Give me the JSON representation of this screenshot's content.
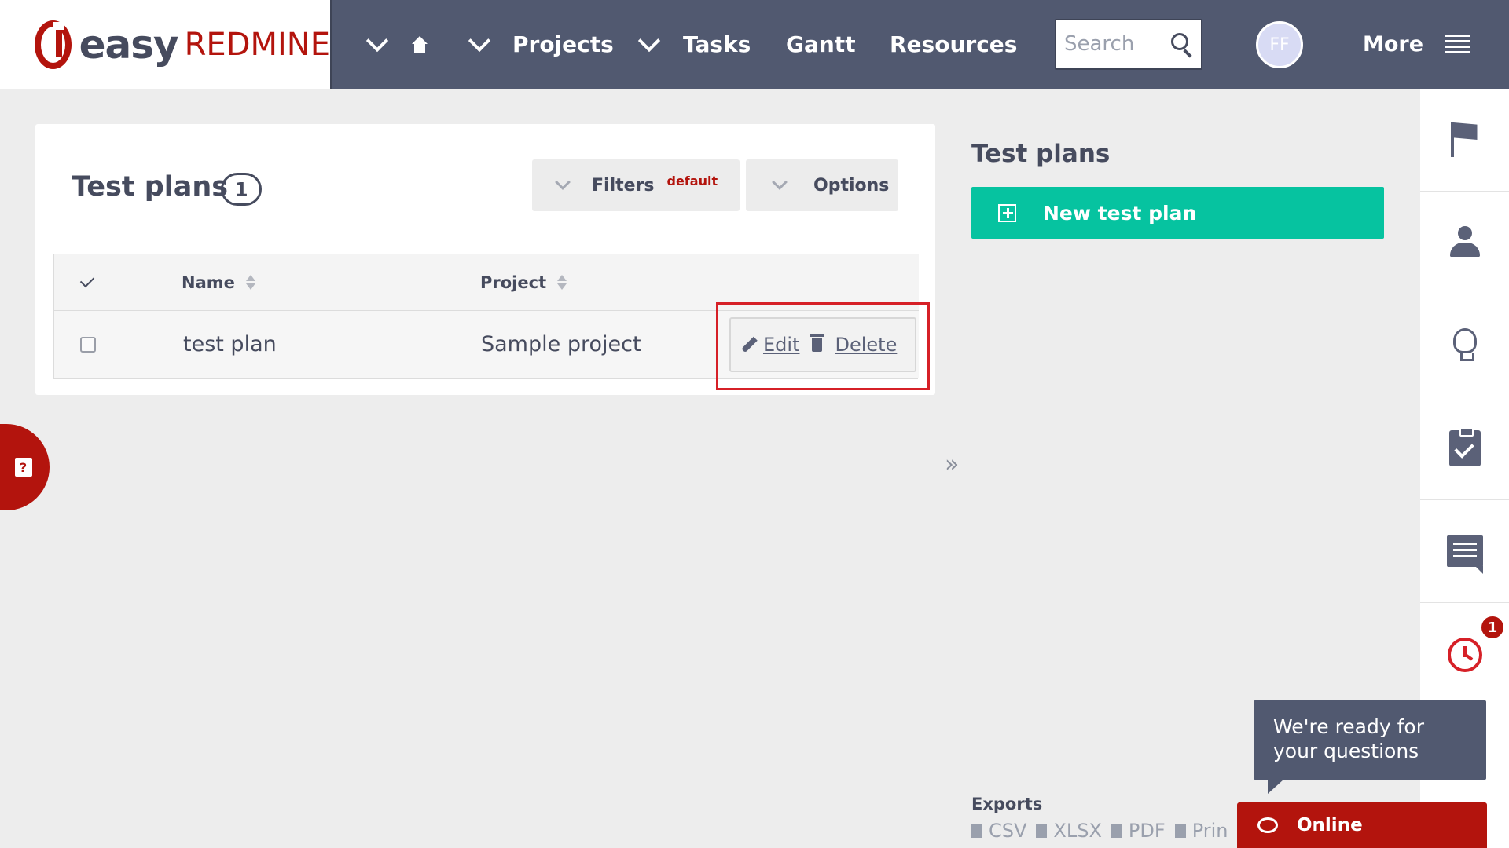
{
  "header": {
    "logo_easy": "easy",
    "logo_redmine": "REDMINE",
    "nav": {
      "projects": "Projects",
      "tasks": "Tasks",
      "gantt": "Gantt",
      "resources": "Resources"
    },
    "search_placeholder": "Search",
    "avatar_initials": "FF",
    "more_label": "More"
  },
  "main": {
    "title": "Test plans",
    "count": "1",
    "filters_label": "Filters",
    "filters_tag": "default",
    "options_label": "Options",
    "table": {
      "columns": [
        "Name",
        "Project"
      ],
      "rows": [
        {
          "name": "test plan",
          "project": "Sample project",
          "edit": "Edit",
          "delete": "Delete"
        }
      ]
    }
  },
  "sidebar": {
    "title": "Test plans",
    "new_button": "New test plan",
    "collapse": "»",
    "exports_label": "Exports",
    "exports": [
      "CSV",
      "XLSX",
      "PDF",
      "Prin"
    ]
  },
  "rail": {
    "alarm_count": "1"
  },
  "help": {
    "icon": "?"
  },
  "chat": {
    "bubble_text": "We're ready for your questions",
    "online_label": "Online"
  },
  "colors": {
    "brand_red": "#b3140d",
    "topbar": "#515970",
    "accent_green": "#06c3a0",
    "highlight": "#d62027"
  }
}
